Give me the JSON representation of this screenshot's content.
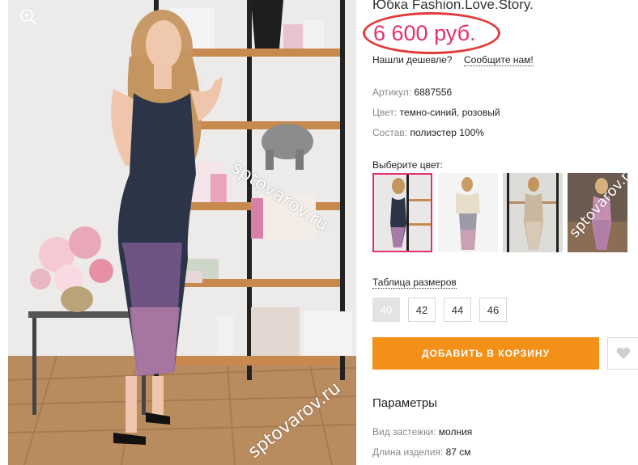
{
  "product": {
    "title": "Юбка  Fashion.Love.Story.",
    "price": "6 600 руб.",
    "cheaper_text": "Нашли дешевле?",
    "cheaper_link": "Сообщите нам!",
    "attributes": [
      {
        "key": "Артикул:",
        "value": "6887556"
      },
      {
        "key": "Цвет:",
        "value": "темно-синий, розовый"
      },
      {
        "key": "Состав:",
        "value": "полиэстер 100%"
      }
    ]
  },
  "color_picker": {
    "label": "Выберите цвет:",
    "selected_index": 0
  },
  "sizes": {
    "table_link": "Таблица размеров",
    "options": [
      "40",
      "42",
      "44",
      "46"
    ],
    "selected": "40"
  },
  "actions": {
    "add_to_cart": "ДОБАВИТЬ В КОРЗИНУ",
    "favorite_icon": "heart-icon"
  },
  "parameters": {
    "title": "Параметры",
    "items": [
      {
        "key": "Вид застежки:",
        "value": "молния"
      },
      {
        "key": "Длина изделия:",
        "value": "87 см"
      }
    ]
  },
  "watermarks": [
    "sptovarov.ru",
    "sptovarov.ru",
    "sptovarov.ru"
  ],
  "colors": {
    "price": "#e2316a",
    "price_oval": "#e23b3b",
    "cart_button": "#f39017",
    "selected_thumb_border": "#e2316a"
  }
}
